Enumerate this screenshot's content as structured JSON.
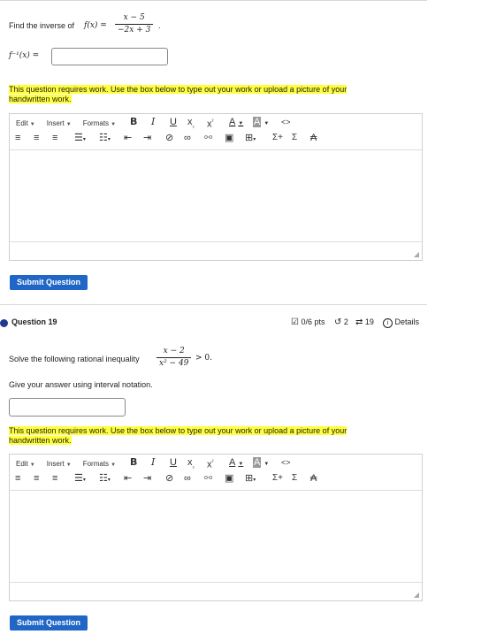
{
  "question18": {
    "prompt": "Find the inverse of",
    "func_lhs": "f(x) =",
    "numerator": "x − 5",
    "denominator": "−2x + 3",
    "period": ".",
    "answer_label": "f⁻¹(x) =",
    "answer_value": "",
    "work_notice": "This question requires work.  Use the box below to type out your work or upload a picture of your handwritten work.",
    "submit_label": "Submit Question"
  },
  "question19": {
    "title": "Question 19",
    "points": "0/6 pts",
    "retries": "2",
    "attempts": "19",
    "details": "Details",
    "prompt": "Solve the following rational inequality",
    "numerator": "x − 2",
    "denominator": "x² − 49",
    "inequality": "> 0.",
    "instruction": "Give your answer using interval notation.",
    "answer_value": "",
    "work_notice": "This question requires work.  Use the box below to type out your work or upload a picture of your handwritten work.",
    "submit_label": "Submit Question"
  },
  "editor": {
    "menu_edit": "Edit",
    "menu_insert": "Insert",
    "menu_formats": "Formats",
    "bold": "B",
    "italic": "I",
    "underline": "U",
    "subscript": "x",
    "superscript": "x",
    "font_color": "A",
    "bg_color": "A",
    "source": "<>",
    "sigma_plus": "Σ+",
    "sigma": "Σ"
  },
  "colors": {
    "accent": "#1f66c6",
    "highlight": "#ffff3d",
    "question_dot": "#1f3a93"
  }
}
